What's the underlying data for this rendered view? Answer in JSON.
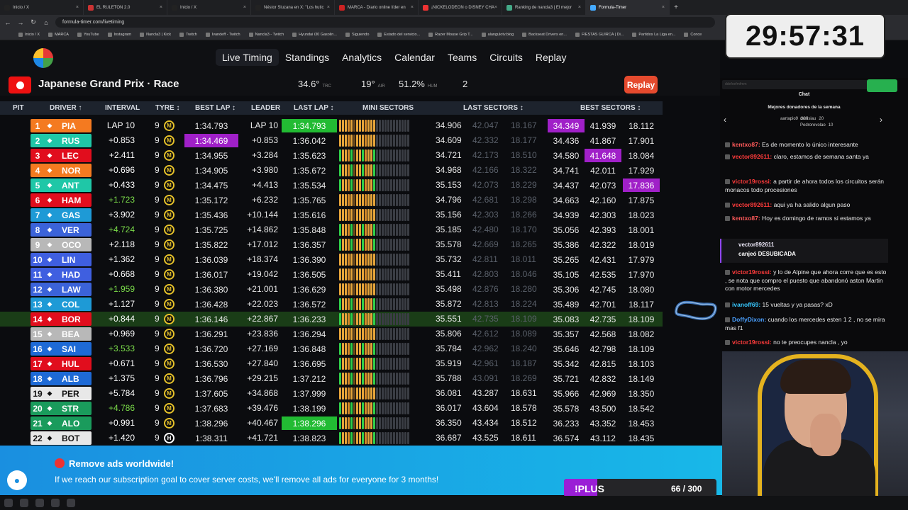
{
  "browser": {
    "tabs": [
      "Inicio / X",
      "EL RULETON 2.0",
      "Inicio / X",
      "Néstor Sluzana en X: \"Los hutic",
      "MARCA - Diario online líder en",
      "¡NICKELODEON o DISNEY CHA",
      "Ranking de nancla3 | El mejor",
      "Formula-Timer"
    ],
    "active_tab_index": 7,
    "url": "formula-timer.com/livetiming",
    "bookmarks": [
      "Inicio / X",
      "MARCA",
      "YouTube",
      "Instagram",
      "Nancla3 | Kick",
      "Twitch",
      "Ivandeff - Twitch",
      "Nancla3 - Twitch",
      "Hyundai i30 Gasolin...",
      "Siguiendo",
      "Estado del servicio...",
      "Razer Mouse Grip T...",
      "alangulotv.blog",
      "Backseat Drivers en...",
      "FIESTAS GUIRCA | Di...",
      "Partidos La Liga en...",
      "Conce"
    ]
  },
  "nav": {
    "items": [
      "Live Timing",
      "Standings",
      "Analytics",
      "Calendar",
      "Teams",
      "Circuits",
      "Replay"
    ],
    "active": "Live Timing"
  },
  "race": {
    "title": "Japanese Grand Prix · Race",
    "track_temp": "34.6°",
    "track_temp_label": "TRC",
    "air_temp": "19°",
    "air_label": "AIR",
    "humidity": "51.2%",
    "humidity_label": "HUM",
    "wind": "2",
    "replay_button": "Replay"
  },
  "table": {
    "headers": {
      "pit": "PIT",
      "driver": "DRIVER ↑",
      "interval": "INTERVAL",
      "tyre": "TYRE ↕",
      "best_lap": "BEST LAP ↕",
      "leader": "LEADER",
      "last_lap": "LAST LAP ↕",
      "mini_sectors": "MINI SECTORS",
      "last_sectors": "LAST SECTORS ↕",
      "best_sectors": "BEST SECTORS ↕"
    },
    "rows": [
      {
        "pos": "1",
        "code": "PIA",
        "color": "#f47a20",
        "interval": "LAP 10",
        "int_color": "#ffffff",
        "tyre": "M",
        "laps": "9",
        "best": "1:34.793",
        "best_hl": "",
        "leader": "LAP 10",
        "last": "1:34.793",
        "last_hl": "green",
        "ls": [
          "34.906",
          "42.047",
          "18.167"
        ],
        "ls_dim": [
          false,
          true,
          true
        ],
        "bs": [
          "34.349",
          "41.939",
          "18.112"
        ],
        "bs_hl": [
          "purple",
          "",
          ""
        ]
      },
      {
        "pos": "2",
        "code": "RUS",
        "color": "#1fc7a7",
        "interval": "+0.853",
        "int_color": "#ffffff",
        "tyre": "M",
        "laps": "9",
        "best": "1:34.469",
        "best_hl": "purple",
        "leader": "+0.853",
        "last": "1:36.042",
        "last_hl": "",
        "ls": [
          "34.609",
          "42.332",
          "18.177"
        ],
        "ls_dim": [
          false,
          true,
          true
        ],
        "bs": [
          "34.436",
          "41.867",
          "17.901"
        ],
        "bs_hl": [
          "",
          "",
          ""
        ]
      },
      {
        "pos": "3",
        "code": "LEC",
        "color": "#e10d1d",
        "interval": "+2.411",
        "int_color": "#ffffff",
        "tyre": "M",
        "laps": "9",
        "best": "1:34.955",
        "best_hl": "",
        "leader": "+3.284",
        "last": "1:35.623",
        "last_hl": "",
        "ls": [
          "34.721",
          "42.173",
          "18.510"
        ],
        "ls_dim": [
          false,
          true,
          true
        ],
        "bs": [
          "34.580",
          "41.648",
          "18.084"
        ],
        "bs_hl": [
          "",
          "purple",
          ""
        ]
      },
      {
        "pos": "4",
        "code": "NOR",
        "color": "#f47a20",
        "interval": "+0.696",
        "int_color": "#ffffff",
        "tyre": "M",
        "laps": "9",
        "best": "1:34.905",
        "best_hl": "",
        "leader": "+3.980",
        "last": "1:35.672",
        "last_hl": "",
        "ls": [
          "34.968",
          "42.166",
          "18.322"
        ],
        "ls_dim": [
          false,
          true,
          true
        ],
        "bs": [
          "34.741",
          "42.011",
          "17.929"
        ],
        "bs_hl": [
          "",
          "",
          ""
        ]
      },
      {
        "pos": "5",
        "code": "ANT",
        "color": "#1fc7a7",
        "interval": "+0.433",
        "int_color": "#ffffff",
        "tyre": "M",
        "laps": "9",
        "best": "1:34.475",
        "best_hl": "",
        "leader": "+4.413",
        "last": "1:35.534",
        "last_hl": "",
        "ls": [
          "35.153",
          "42.073",
          "18.229"
        ],
        "ls_dim": [
          false,
          true,
          true
        ],
        "bs": [
          "34.437",
          "42.073",
          "17.836"
        ],
        "bs_hl": [
          "",
          "",
          "purple"
        ]
      },
      {
        "pos": "6",
        "code": "HAM",
        "color": "#e10d1d",
        "interval": "+1.723",
        "int_color": "#7bdc4a",
        "tyre": "M",
        "laps": "9",
        "best": "1:35.172",
        "best_hl": "",
        "leader": "+6.232",
        "last": "1:35.765",
        "last_hl": "",
        "ls": [
          "34.796",
          "42.681",
          "18.298"
        ],
        "ls_dim": [
          false,
          true,
          true
        ],
        "bs": [
          "34.663",
          "42.160",
          "17.875"
        ],
        "bs_hl": [
          "",
          "",
          ""
        ]
      },
      {
        "pos": "7",
        "code": "GAS",
        "color": "#1e9ad6",
        "interval": "+3.902",
        "int_color": "#ffffff",
        "tyre": "M",
        "laps": "9",
        "best": "1:35.436",
        "best_hl": "",
        "leader": "+10.144",
        "last": "1:35.616",
        "last_hl": "",
        "ls": [
          "35.156",
          "42.303",
          "18.266"
        ],
        "ls_dim": [
          false,
          true,
          true
        ],
        "bs": [
          "34.939",
          "42.303",
          "18.023"
        ],
        "bs_hl": [
          "",
          "",
          ""
        ]
      },
      {
        "pos": "8",
        "code": "VER",
        "color": "#3b63d9",
        "interval": "+4.724",
        "int_color": "#7bdc4a",
        "tyre": "M",
        "laps": "9",
        "best": "1:35.725",
        "best_hl": "",
        "leader": "+14.862",
        "last": "1:35.848",
        "last_hl": "",
        "ls": [
          "35.185",
          "42.480",
          "18.170"
        ],
        "ls_dim": [
          false,
          true,
          true
        ],
        "bs": [
          "35.056",
          "42.393",
          "18.001"
        ],
        "bs_hl": [
          "",
          "",
          ""
        ]
      },
      {
        "pos": "9",
        "code": "OCO",
        "color": "#b8b8b8",
        "interval": "+2.118",
        "int_color": "#ffffff",
        "tyre": "M",
        "laps": "9",
        "best": "1:35.822",
        "best_hl": "",
        "leader": "+17.012",
        "last": "1:36.357",
        "last_hl": "",
        "ls": [
          "35.578",
          "42.669",
          "18.265"
        ],
        "ls_dim": [
          false,
          true,
          true
        ],
        "bs": [
          "35.386",
          "42.322",
          "18.019"
        ],
        "bs_hl": [
          "",
          "",
          ""
        ]
      },
      {
        "pos": "10",
        "code": "LIN",
        "color": "#3f5fe0",
        "interval": "+1.362",
        "int_color": "#ffffff",
        "tyre": "M",
        "laps": "9",
        "best": "1:36.039",
        "best_hl": "",
        "leader": "+18.374",
        "last": "1:36.390",
        "last_hl": "",
        "ls": [
          "35.732",
          "42.811",
          "18.011"
        ],
        "ls_dim": [
          false,
          true,
          true
        ],
        "bs": [
          "35.265",
          "42.431",
          "17.979"
        ],
        "bs_hl": [
          "",
          "",
          ""
        ]
      },
      {
        "pos": "11",
        "code": "HAD",
        "color": "#3f5fe0",
        "interval": "+0.668",
        "int_color": "#ffffff",
        "tyre": "M",
        "laps": "9",
        "best": "1:36.017",
        "best_hl": "",
        "leader": "+19.042",
        "last": "1:36.505",
        "last_hl": "",
        "ls": [
          "35.411",
          "42.803",
          "18.046"
        ],
        "ls_dim": [
          false,
          true,
          true
        ],
        "bs": [
          "35.105",
          "42.535",
          "17.970"
        ],
        "bs_hl": [
          "",
          "",
          ""
        ]
      },
      {
        "pos": "12",
        "code": "LAW",
        "color": "#3b63d9",
        "interval": "+1.959",
        "int_color": "#7bdc4a",
        "tyre": "M",
        "laps": "9",
        "best": "1:36.380",
        "best_hl": "",
        "leader": "+21.001",
        "last": "1:36.629",
        "last_hl": "",
        "ls": [
          "35.498",
          "42.876",
          "18.280"
        ],
        "ls_dim": [
          false,
          true,
          true
        ],
        "bs": [
          "35.306",
          "42.745",
          "18.080"
        ],
        "bs_hl": [
          "",
          "",
          ""
        ]
      },
      {
        "pos": "13",
        "code": "COL",
        "color": "#1e9ad6",
        "interval": "+1.127",
        "int_color": "#ffffff",
        "tyre": "M",
        "laps": "9",
        "best": "1:36.428",
        "best_hl": "",
        "leader": "+22.023",
        "last": "1:36.572",
        "last_hl": "",
        "ls": [
          "35.872",
          "42.813",
          "18.224"
        ],
        "ls_dim": [
          false,
          true,
          true
        ],
        "bs": [
          "35.489",
          "42.701",
          "18.117"
        ],
        "bs_hl": [
          "",
          "",
          ""
        ]
      },
      {
        "pos": "14",
        "code": "BOR",
        "color": "#e10d1d",
        "interval": "+0.844",
        "int_color": "#ffffff",
        "tyre": "M",
        "laps": "9",
        "best": "1:36.146",
        "best_hl": "",
        "leader": "+22.867",
        "last": "1:36.233",
        "last_hl": "",
        "ls": [
          "35.551",
          "42.735",
          "18.109"
        ],
        "ls_dim": [
          false,
          true,
          true
        ],
        "bs": [
          "35.083",
          "42.735",
          "18.109"
        ],
        "bs_hl": [
          "",
          "",
          ""
        ],
        "row_hl": true
      },
      {
        "pos": "15",
        "code": "BEA",
        "color": "#b8b8b8",
        "interval": "+0.969",
        "int_color": "#ffffff",
        "tyre": "M",
        "laps": "9",
        "best": "1:36.291",
        "best_hl": "",
        "leader": "+23.836",
        "last": "1:36.294",
        "last_hl": "",
        "ls": [
          "35.806",
          "42.612",
          "18.089"
        ],
        "ls_dim": [
          false,
          true,
          true
        ],
        "bs": [
          "35.357",
          "42.568",
          "18.082"
        ],
        "bs_hl": [
          "",
          "",
          ""
        ]
      },
      {
        "pos": "16",
        "code": "SAI",
        "color": "#1e6ad6",
        "interval": "+3.533",
        "int_color": "#7bdc4a",
        "tyre": "M",
        "laps": "9",
        "best": "1:36.720",
        "best_hl": "",
        "leader": "+27.169",
        "last": "1:36.848",
        "last_hl": "",
        "ls": [
          "35.784",
          "42.962",
          "18.240"
        ],
        "ls_dim": [
          false,
          true,
          true
        ],
        "bs": [
          "35.646",
          "42.798",
          "18.109"
        ],
        "bs_hl": [
          "",
          "",
          ""
        ]
      },
      {
        "pos": "17",
        "code": "HUL",
        "color": "#e10d1d",
        "interval": "+0.671",
        "int_color": "#ffffff",
        "tyre": "M",
        "laps": "9",
        "best": "1:36.530",
        "best_hl": "",
        "leader": "+27.840",
        "last": "1:36.695",
        "last_hl": "",
        "ls": [
          "35.919",
          "42.961",
          "18.187"
        ],
        "ls_dim": [
          false,
          true,
          true
        ],
        "bs": [
          "35.342",
          "42.815",
          "18.103"
        ],
        "bs_hl": [
          "",
          "",
          ""
        ]
      },
      {
        "pos": "18",
        "code": "ALB",
        "color": "#1e6ad6",
        "interval": "+1.375",
        "int_color": "#ffffff",
        "tyre": "M",
        "laps": "9",
        "best": "1:36.796",
        "best_hl": "",
        "leader": "+29.215",
        "last": "1:37.212",
        "last_hl": "",
        "ls": [
          "35.788",
          "43.091",
          "18.269"
        ],
        "ls_dim": [
          false,
          true,
          true
        ],
        "bs": [
          "35.721",
          "42.832",
          "18.149"
        ],
        "bs_hl": [
          "",
          "",
          ""
        ]
      },
      {
        "pos": "19",
        "code": "PER",
        "color": "#e8e8e8",
        "interval": "+5.784",
        "int_color": "#ffffff",
        "tyre": "M",
        "laps": "9",
        "best": "1:37.605",
        "best_hl": "",
        "leader": "+34.868",
        "last": "1:37.999",
        "last_hl": "",
        "ls": [
          "36.081",
          "43.287",
          "18.631"
        ],
        "ls_dim": [
          false,
          false,
          false
        ],
        "bs": [
          "35.966",
          "42.969",
          "18.350"
        ],
        "bs_hl": [
          "",
          "",
          ""
        ],
        "dark_text": true
      },
      {
        "pos": "20",
        "code": "STR",
        "color": "#1a9b5c",
        "interval": "+4.786",
        "int_color": "#7bdc4a",
        "tyre": "M",
        "laps": "9",
        "best": "1:37.683",
        "best_hl": "",
        "leader": "+39.476",
        "last": "1:38.199",
        "last_hl": "",
        "ls": [
          "36.017",
          "43.604",
          "18.578"
        ],
        "ls_dim": [
          false,
          false,
          false
        ],
        "bs": [
          "35.578",
          "43.500",
          "18.542"
        ],
        "bs_hl": [
          "",
          "",
          ""
        ]
      },
      {
        "pos": "21",
        "code": "ALO",
        "color": "#1a9b5c",
        "interval": "+0.991",
        "int_color": "#ffffff",
        "tyre": "M",
        "laps": "9",
        "best": "1:38.296",
        "best_hl": "",
        "leader": "+40.467",
        "last": "1:38.296",
        "last_hl": "green",
        "ls": [
          "36.350",
          "43.434",
          "18.512"
        ],
        "ls_dim": [
          false,
          false,
          false
        ],
        "bs": [
          "36.233",
          "43.352",
          "18.453"
        ],
        "bs_hl": [
          "",
          "",
          ""
        ]
      },
      {
        "pos": "22",
        "code": "BOT",
        "color": "#e8e8e8",
        "interval": "+1.420",
        "int_color": "#ffffff",
        "tyre": "H",
        "laps": "9",
        "best": "1:38.311",
        "best_hl": "",
        "leader": "+41.721",
        "last": "1:38.823",
        "last_hl": "",
        "ls": [
          "36.687",
          "43.525",
          "18.611"
        ],
        "ls_dim": [
          false,
          false,
          false
        ],
        "bs": [
          "36.574",
          "43.112",
          "18.435"
        ],
        "bs_hl": [
          "",
          "",
          ""
        ],
        "dark_text": true
      }
    ]
  },
  "stream": {
    "timer": "29:57:31",
    "chat_title": "Chat",
    "input_placeholder": "ddefoefmfmm",
    "donors_title": "Mejores donadores de la semana",
    "donors": [
      {
        "name": "aartapio9",
        "amount": "300"
      },
      {
        "name": "denisiau",
        "amount": "20"
      },
      {
        "name": "Pedrorevolao",
        "amount": "10"
      }
    ],
    "messages": [
      {
        "user": "kentxo87:",
        "color": "#ff5a5a",
        "text": " Es de momento lo único interesante"
      },
      {
        "user": "vector892611:",
        "color": "#ff3b3b",
        "text": " claro, estamos de semana santa ya"
      },
      {
        "user": "victor19rossi:",
        "color": "#ff3b3b",
        "text": " a partir de ahora todos los circuitos serán monacos todo procesiones"
      },
      {
        "user": "vector892611:",
        "color": "#ff3b3b",
        "text": " aqui ya ha salido algun paso"
      },
      {
        "user": "kentxo87:",
        "color": "#ff5a5a",
        "text": " Hoy es domingo de ramos si estamos ya"
      },
      {
        "user": "victor19rossi:",
        "color": "#ff3b3b",
        "text": " y lo de Alpine que ahora corre que es esto , se nota que compro el puesto que abandonó aston Martin con motor mercedes"
      },
      {
        "user": "ivanoff69:",
        "color": "#37c8ff",
        "text": " 15 vueltas y ya pasas? xD"
      },
      {
        "user": "DoffyDixon:",
        "color": "#4aa0ff",
        "text": " cuando los mercedes esten 1 2 , no se mira mas f1"
      },
      {
        "user": "victor19rossi:",
        "color": "#ff3b3b",
        "text": " no te preocupes nancla , yo"
      }
    ],
    "redeem_user": "vector892611",
    "redeem_text": "canjeó DESUBICADA"
  },
  "banner": {
    "title": "Remove ads worldwide!",
    "text": "If we reach our subscription goal to cover server costs, we'll remove all ads for everyone for 3 months!",
    "plus_label": "!PLUS",
    "plus_count": "66 / 300",
    "plus_progress": 0.22
  }
}
